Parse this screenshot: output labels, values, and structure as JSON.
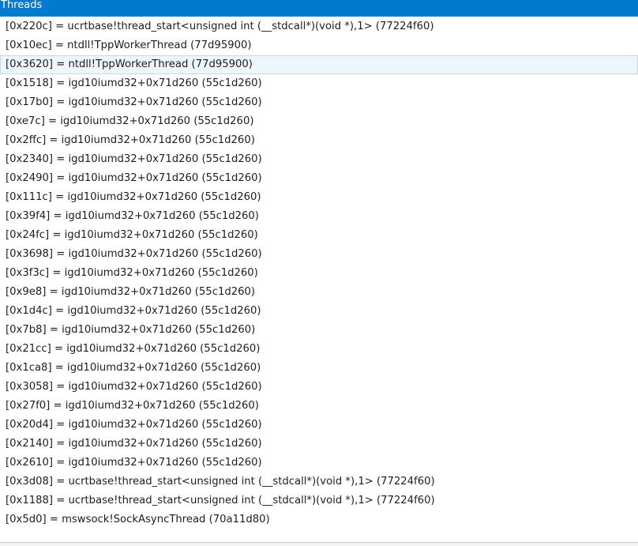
{
  "panel": {
    "title": "Threads",
    "accent_color": "#007acc"
  },
  "threads": [
    {
      "label": "[0x220c] = ucrtbase!thread_start<unsigned int (__stdcall*)(void *),1> (77224f60)"
    },
    {
      "label": "[0x10ec] = ntdll!TppWorkerThread (77d95900)"
    },
    {
      "label": "[0x3620] = ntdll!TppWorkerThread (77d95900)",
      "selected": true
    },
    {
      "label": "[0x1518] = igd10iumd32+0x71d260 (55c1d260)"
    },
    {
      "label": "[0x17b0] = igd10iumd32+0x71d260 (55c1d260)"
    },
    {
      "label": "[0xe7c] = igd10iumd32+0x71d260 (55c1d260)"
    },
    {
      "label": "[0x2ffc] = igd10iumd32+0x71d260 (55c1d260)"
    },
    {
      "label": "[0x2340] = igd10iumd32+0x71d260 (55c1d260)"
    },
    {
      "label": "[0x2490] = igd10iumd32+0x71d260 (55c1d260)"
    },
    {
      "label": "[0x111c] = igd10iumd32+0x71d260 (55c1d260)"
    },
    {
      "label": "[0x39f4] = igd10iumd32+0x71d260 (55c1d260)"
    },
    {
      "label": "[0x24fc] = igd10iumd32+0x71d260 (55c1d260)"
    },
    {
      "label": "[0x3698] = igd10iumd32+0x71d260 (55c1d260)"
    },
    {
      "label": "[0x3f3c] = igd10iumd32+0x71d260 (55c1d260)"
    },
    {
      "label": "[0x9e8] = igd10iumd32+0x71d260 (55c1d260)"
    },
    {
      "label": "[0x1d4c] = igd10iumd32+0x71d260 (55c1d260)"
    },
    {
      "label": "[0x7b8] = igd10iumd32+0x71d260 (55c1d260)"
    },
    {
      "label": "[0x21cc] = igd10iumd32+0x71d260 (55c1d260)"
    },
    {
      "label": "[0x1ca8] = igd10iumd32+0x71d260 (55c1d260)"
    },
    {
      "label": "[0x3058] = igd10iumd32+0x71d260 (55c1d260)"
    },
    {
      "label": "[0x27f0] = igd10iumd32+0x71d260 (55c1d260)"
    },
    {
      "label": "[0x20d4] = igd10iumd32+0x71d260 (55c1d260)"
    },
    {
      "label": "[0x2140] = igd10iumd32+0x71d260 (55c1d260)"
    },
    {
      "label": "[0x2610] = igd10iumd32+0x71d260 (55c1d260)"
    },
    {
      "label": "[0x3d08] = ucrtbase!thread_start<unsigned int (__stdcall*)(void *),1> (77224f60)"
    },
    {
      "label": "[0x1188] = ucrtbase!thread_start<unsigned int (__stdcall*)(void *),1> (77224f60)"
    },
    {
      "label": "[0x5d0] = mswsock!SockAsyncThread (70a11d80)"
    }
  ]
}
